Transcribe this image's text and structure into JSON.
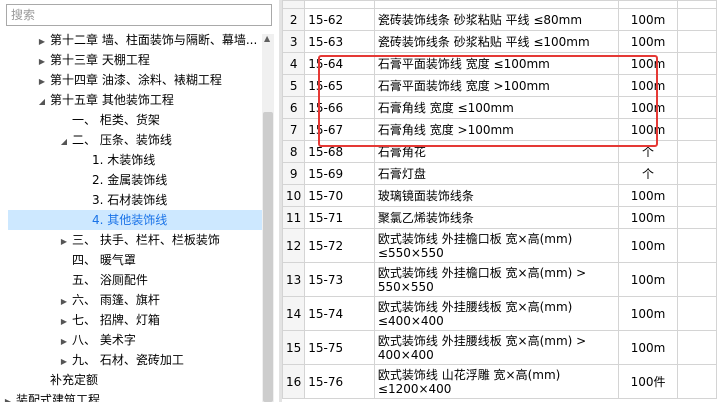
{
  "search": {
    "placeholder": "搜索"
  },
  "tree": [
    {
      "label": "第十二章 墙、柱面装饰与隔断、幕墙...",
      "arrow": "right"
    },
    {
      "label": "第十三章 天棚工程",
      "arrow": "right"
    },
    {
      "label": "第十四章 油漆、涂料、裱糊工程",
      "arrow": "right"
    },
    {
      "label": "第十五章 其他装饰工程",
      "arrow": "down"
    },
    {
      "label": "一、 柜类、货架",
      "arrow": ""
    },
    {
      "label": "二、 压条、装饰线",
      "arrow": "down"
    },
    {
      "label": "1. 木装饰线",
      "arrow": ""
    },
    {
      "label": "2. 金属装饰线",
      "arrow": ""
    },
    {
      "label": "3. 石材装饰线",
      "arrow": ""
    },
    {
      "label": "4. 其他装饰线",
      "arrow": ""
    },
    {
      "label": "三、 扶手、栏杆、栏板装饰",
      "arrow": "right"
    },
    {
      "label": "四、 暖气罩",
      "arrow": ""
    },
    {
      "label": "五、 浴厕配件",
      "arrow": ""
    },
    {
      "label": "六、 雨篷、旗杆",
      "arrow": "right"
    },
    {
      "label": "七、 招牌、灯箱",
      "arrow": "right"
    },
    {
      "label": "八、 美术字",
      "arrow": "right"
    },
    {
      "label": "九、 石材、瓷砖加工",
      "arrow": "right"
    },
    {
      "label": "补充定额",
      "arrow": ""
    },
    {
      "label": "装配式建筑工程",
      "arrow": "right"
    }
  ],
  "rows": [
    {
      "no": "2",
      "code": "15-62",
      "name": "瓷砖装饰线条 砂浆粘贴 平线 ≤80mm",
      "unit": "100m"
    },
    {
      "no": "3",
      "code": "15-63",
      "name": "瓷砖装饰线条 砂浆粘贴 平线 ≤100mm",
      "unit": "100m"
    },
    {
      "no": "4",
      "code": "15-64",
      "name": "石膏平面装饰线 宽度 ≤100mm",
      "unit": "100m"
    },
    {
      "no": "5",
      "code": "15-65",
      "name": "石膏平面装饰线 宽度 >100mm",
      "unit": "100m"
    },
    {
      "no": "6",
      "code": "15-66",
      "name": "石膏角线 宽度 ≤100mm",
      "unit": "100m"
    },
    {
      "no": "7",
      "code": "15-67",
      "name": "石膏角线 宽度 >100mm",
      "unit": "100m"
    },
    {
      "no": "8",
      "code": "15-68",
      "name": "石膏角花",
      "unit": "个"
    },
    {
      "no": "9",
      "code": "15-69",
      "name": "石膏灯盘",
      "unit": "个"
    },
    {
      "no": "10",
      "code": "15-70",
      "name": "玻璃镜面装饰线条",
      "unit": "100m"
    },
    {
      "no": "11",
      "code": "15-71",
      "name": "聚氯乙烯装饰线条",
      "unit": "100m"
    },
    {
      "no": "12",
      "code": "15-72",
      "name": "欧式装饰线 外挂檐口板 宽×高(mm) ≤550×550",
      "unit": "100m"
    },
    {
      "no": "13",
      "code": "15-73",
      "name": "欧式装饰线 外挂檐口板 宽×高(mm) > 550×550",
      "unit": "100m"
    },
    {
      "no": "14",
      "code": "15-74",
      "name": "欧式装饰线 外挂腰线板 宽×高(mm) ≤400×400",
      "unit": "100m"
    },
    {
      "no": "15",
      "code": "15-75",
      "name": "欧式装饰线 外挂腰线板 宽×高(mm) > 400×400",
      "unit": "100m"
    },
    {
      "no": "16",
      "code": "15-76",
      "name": "欧式装饰线 山花浮雕 宽×高(mm) ≤1200×400",
      "unit": "100件"
    }
  ],
  "colors": {
    "selected_bg": "#cde8ff",
    "highlight_box": "#e53935"
  }
}
